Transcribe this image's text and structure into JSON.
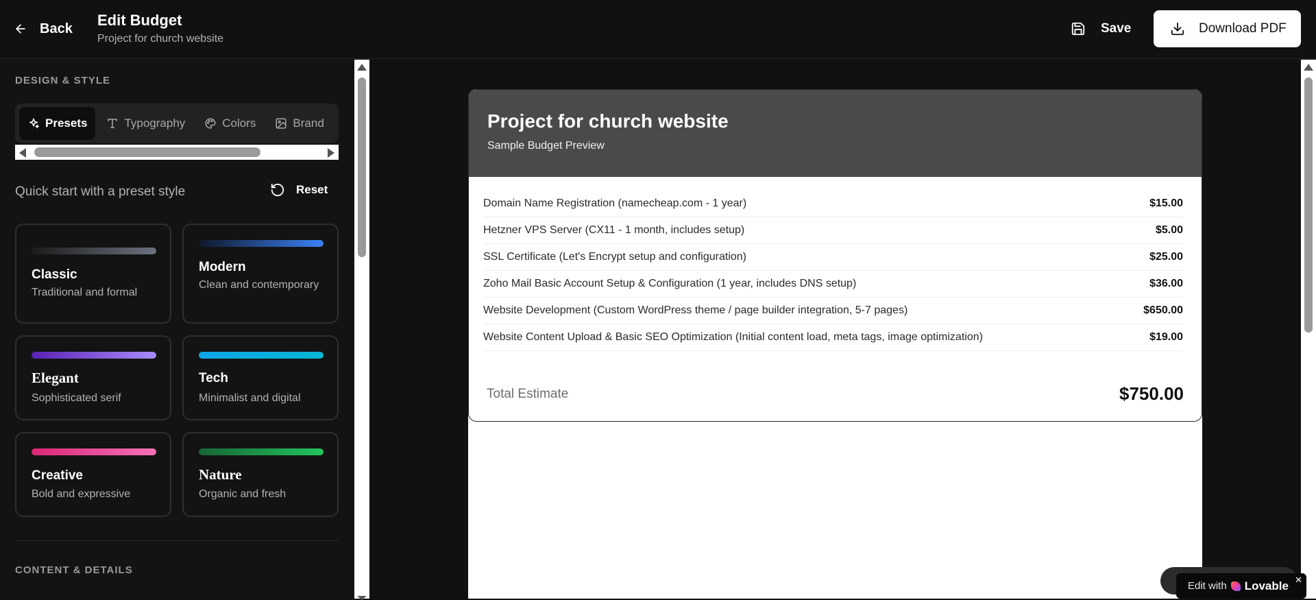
{
  "header": {
    "back_label": "Back",
    "title": "Edit Budget",
    "subtitle": "Project for church website",
    "save_label": "Save",
    "download_label": "Download PDF"
  },
  "sidebar": {
    "design_heading": "DESIGN & STYLE",
    "tabs": [
      {
        "label": "Presets",
        "icon": "sparkles-icon",
        "active": true
      },
      {
        "label": "Typography",
        "icon": "type-icon"
      },
      {
        "label": "Colors",
        "icon": "palette-icon"
      },
      {
        "label": "Brand",
        "icon": "image-icon"
      }
    ],
    "quick_start": "Quick start with a preset style",
    "reset_label": "Reset",
    "presets": [
      {
        "name": "Classic",
        "desc": "Traditional and formal",
        "colors": [
          "#1a1a1a",
          "#6b7280"
        ]
      },
      {
        "name": "Modern",
        "desc": "Clean and contemporary",
        "colors": [
          "#0f172a",
          "#3b82f6"
        ]
      },
      {
        "name": "Elegant",
        "desc": "Sophisticated serif",
        "colors": [
          "#5b21b6",
          "#a78bfa"
        ]
      },
      {
        "name": "Tech",
        "desc": "Minimalist and digital",
        "colors": [
          "#0ea5e9",
          "#06b6d4"
        ]
      },
      {
        "name": "Creative",
        "desc": "Bold and expressive",
        "colors": [
          "#db2777",
          "#f472b6"
        ]
      },
      {
        "name": "Nature",
        "desc": "Organic and fresh",
        "colors": [
          "#166534",
          "#22c55e"
        ]
      }
    ],
    "content_heading": "CONTENT & DETAILS"
  },
  "preview": {
    "title": "Project for church website",
    "subtitle": "Sample Budget Preview",
    "items": [
      {
        "desc": "Domain Name Registration (namecheap.com - 1 year)",
        "amount": "$15.00"
      },
      {
        "desc": "Hetzner VPS Server (CX11 - 1 month, includes setup)",
        "amount": "$5.00"
      },
      {
        "desc": "SSL Certificate (Let's Encrypt setup and configuration)",
        "amount": "$25.00"
      },
      {
        "desc": "Zoho Mail Basic Account Setup & Configuration (1 year, includes DNS setup)",
        "amount": "$36.00"
      },
      {
        "desc": "Website Development (Custom WordPress theme / page builder integration, 5-7 pages)",
        "amount": "$650.00"
      },
      {
        "desc": "Website Content Upload & Basic SEO Optimization (Initial content load, meta tags, image optimization)",
        "amount": "$19.00"
      }
    ],
    "total_label": "Total Estimate",
    "total_value": "$750.00"
  },
  "badge": {
    "edit_with": "Edit with",
    "brand": "Lovable",
    "close": "✕"
  }
}
